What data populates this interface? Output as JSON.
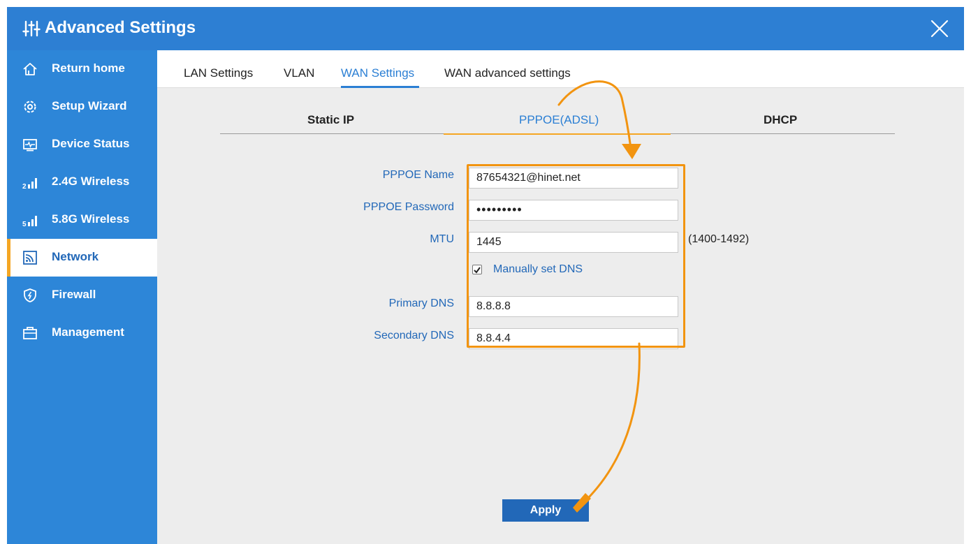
{
  "window": {
    "title": "Advanced Settings",
    "title_icon": "sliders-icon",
    "close_icon": "close-icon"
  },
  "sidebar": {
    "items": [
      {
        "label": "Return home",
        "icon": "home-icon"
      },
      {
        "label": "Setup Wizard",
        "icon": "gear-icon"
      },
      {
        "label": "Device Status",
        "icon": "monitor-pulse-icon"
      },
      {
        "label": "2.4G Wireless",
        "icon": "signal-2g-icon"
      },
      {
        "label": "5.8G Wireless",
        "icon": "signal-5g-icon"
      },
      {
        "label": "Network",
        "icon": "network-icon",
        "active": true
      },
      {
        "label": "Firewall",
        "icon": "shield-icon"
      },
      {
        "label": "Management",
        "icon": "toolbox-icon"
      }
    ]
  },
  "tabs": [
    {
      "label": "LAN Settings"
    },
    {
      "label": "VLAN"
    },
    {
      "label": "WAN Settings",
      "active": true
    },
    {
      "label": "WAN advanced settings"
    }
  ],
  "subtabs": [
    {
      "label": "Static IP"
    },
    {
      "label": "PPPOE(ADSL)",
      "active": true
    },
    {
      "label": "DHCP"
    }
  ],
  "form": {
    "pppoe_name": {
      "label": "PPPOE Name",
      "value": "87654321@hinet.net"
    },
    "pppoe_password": {
      "label": "PPPOE Password",
      "value": "•••••••••"
    },
    "mtu": {
      "label": "MTU",
      "value": "1445",
      "hint": "(1400-1492)"
    },
    "manual_dns": {
      "label": "Manually set DNS",
      "checked": true
    },
    "primary_dns": {
      "label": "Primary DNS",
      "value": "8.8.8.8"
    },
    "secondary_dns": {
      "label": "Secondary DNS",
      "value": "8.8.4.4"
    }
  },
  "apply_label": "Apply",
  "colors": {
    "header_blue": "#2d7fd3",
    "sidebar_blue": "#2d86d8",
    "accent_blue": "#2268b8",
    "annotation_orange": "#f29410"
  }
}
